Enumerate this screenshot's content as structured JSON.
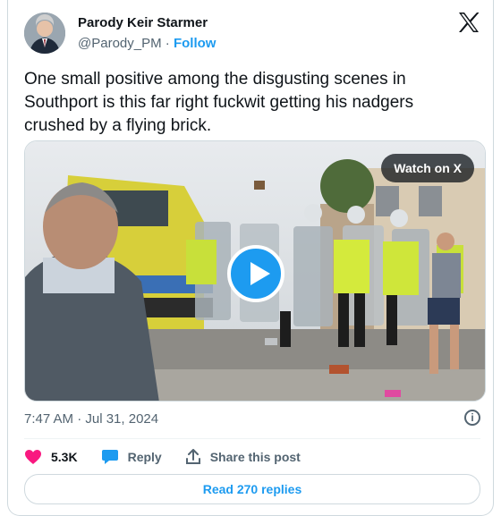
{
  "author": {
    "name": "Parody Keir Starmer",
    "handle": "@Parody_PM",
    "separator": "·",
    "follow_label": "Follow",
    "avatar_icon": "person-avatar"
  },
  "tweet": {
    "text": "One small positive among the disgusting scenes in Southport is this far right fuckwit getting his nadgers crushed by a flying brick."
  },
  "media": {
    "type": "video",
    "watch_label": "Watch on X",
    "play_icon": "play-icon"
  },
  "meta": {
    "timestamp": "7:47 AM · Jul 31, 2024",
    "info_icon": "info-icon"
  },
  "actions": {
    "likes": "5.3K",
    "reply_label": "Reply",
    "share_label": "Share this post"
  },
  "footer": {
    "read_replies_label": "Read 270 replies"
  },
  "colors": {
    "accent": "#1d9bf0",
    "like": "#f91880",
    "text": "#0f1419",
    "secondary": "#536471",
    "border": "#cfd9de"
  }
}
